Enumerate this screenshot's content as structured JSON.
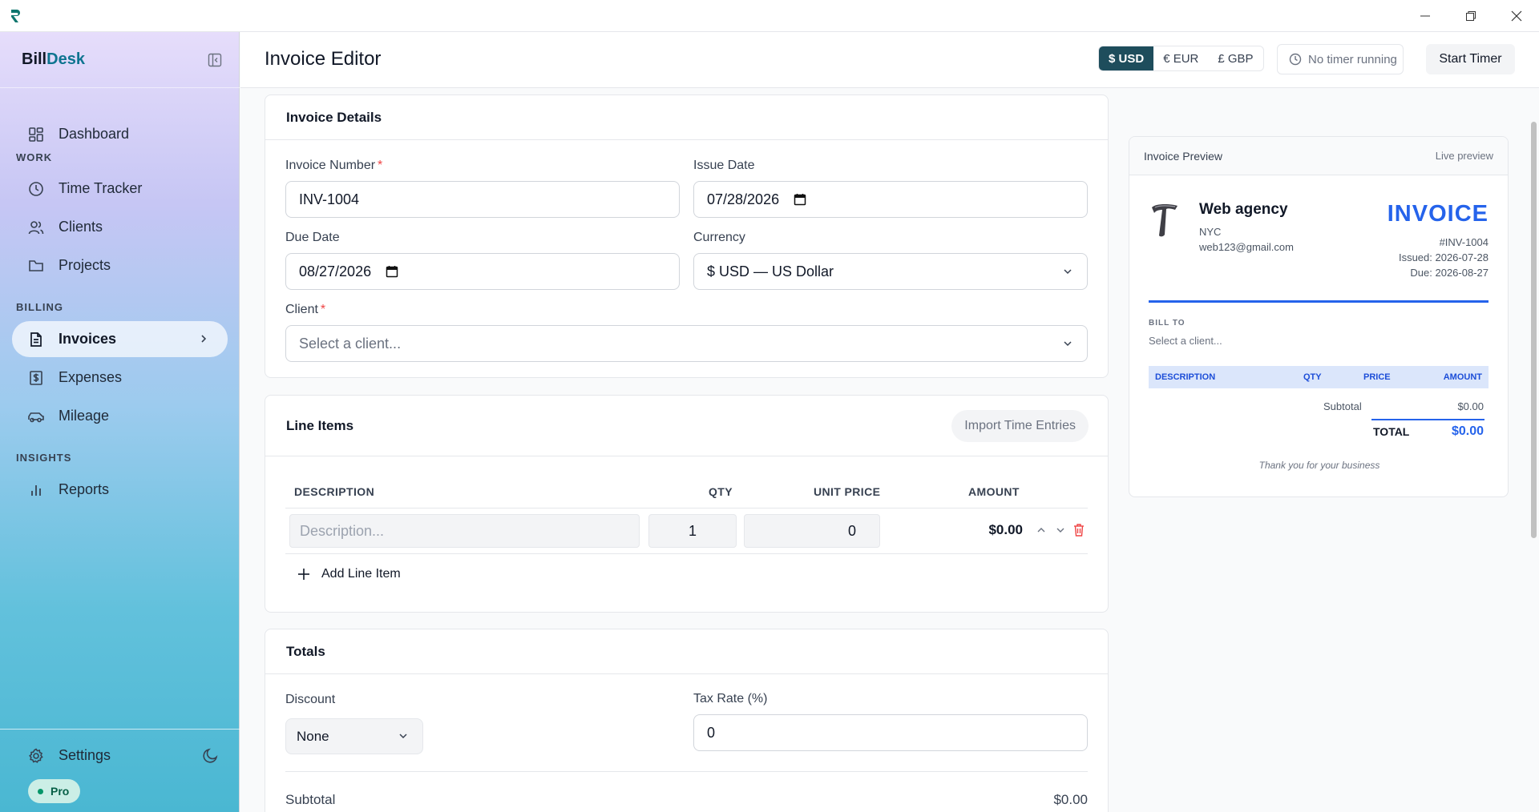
{
  "window": {
    "title_icon": "billdesk-logo",
    "controls": [
      "minimize",
      "restore",
      "close"
    ]
  },
  "brand": {
    "part1": "Bill",
    "part2": "Desk"
  },
  "sidebar": {
    "items": [
      {
        "label": "Dashboard",
        "icon": "dashboard-icon"
      },
      {
        "label": "Time Tracker",
        "icon": "clock-icon"
      },
      {
        "label": "Clients",
        "icon": "users-icon"
      },
      {
        "label": "Projects",
        "icon": "folder-icon"
      },
      {
        "label": "Invoices",
        "icon": "file-icon",
        "active": true
      },
      {
        "label": "Expenses",
        "icon": "dollar-receipt-icon"
      },
      {
        "label": "Mileage",
        "icon": "car-icon"
      },
      {
        "label": "Reports",
        "icon": "bar-chart-icon"
      }
    ],
    "sections": {
      "work": "WORK",
      "billing": "BILLING",
      "insights": "INSIGHTS"
    },
    "settings_label": "Settings",
    "plan_badge": "Pro"
  },
  "header": {
    "title": "Invoice Editor",
    "currencies": [
      "$ USD",
      "€ EUR",
      "£ GBP"
    ],
    "active_currency": "$ USD",
    "timer_status": "No timer running",
    "start_timer_label": "Start Timer"
  },
  "invoice_details": {
    "heading": "Invoice Details",
    "invoice_number_label": "Invoice Number",
    "invoice_number": "INV-1004",
    "issue_date_label": "Issue Date",
    "issue_date": "07/28/2026",
    "due_date_label": "Due Date",
    "due_date": "08/27/2026",
    "currency_label": "Currency",
    "currency_value": "$ USD — US Dollar",
    "client_label": "Client",
    "client_placeholder": "Select a client...",
    "required_mark": "*"
  },
  "line_items": {
    "heading": "Line Items",
    "import_label": "Import Time Entries",
    "columns": [
      "DESCRIPTION",
      "QTY",
      "UNIT PRICE",
      "AMOUNT"
    ],
    "rows": [
      {
        "description_placeholder": "Description...",
        "qty": "1",
        "unit_price": "0",
        "amount": "$0.00"
      }
    ],
    "add_label": "Add Line Item"
  },
  "totals": {
    "heading": "Totals",
    "discount_label": "Discount",
    "discount_value": "None",
    "tax_label": "Tax Rate (%)",
    "tax_value": "0",
    "subtotal_label": "Subtotal",
    "subtotal_value": "$0.00"
  },
  "preview": {
    "heading": "Invoice Preview",
    "live_label": "Live preview",
    "company_name": "Web agency",
    "company_city": "NYC",
    "company_email": "web123@gmail.com",
    "doc_title": "INVOICE",
    "number": "#INV-1004",
    "issued": "Issued: 2026-07-28",
    "due": "Due: 2026-08-27",
    "bill_to_label": "BILL TO",
    "bill_to_value": "Select a client...",
    "columns": [
      "DESCRIPTION",
      "QTY",
      "PRICE",
      "AMOUNT"
    ],
    "subtotal_label": "Subtotal",
    "subtotal_value": "$0.00",
    "total_label": "TOTAL",
    "total_value": "$0.00",
    "footer_note": "Thank you for your business"
  },
  "colors": {
    "accent": "#1e4d5c",
    "brand_teal": "#0e7490",
    "invoice_blue": "#2563eb",
    "danger": "#ef4444"
  }
}
